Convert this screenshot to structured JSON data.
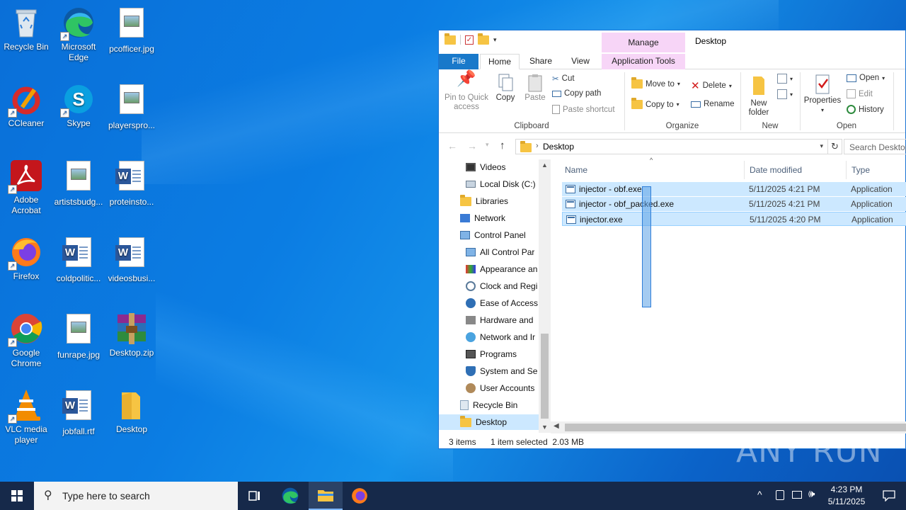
{
  "desktop": {
    "icons": [
      {
        "label": "Recycle Bin"
      },
      {
        "label": "Microsoft Edge"
      },
      {
        "label": "pcofficer.jpg"
      },
      {
        "label": "CCleaner"
      },
      {
        "label": "Skype"
      },
      {
        "label": "playerspro..."
      },
      {
        "label": "Adobe Acrobat"
      },
      {
        "label": "artistsbudg..."
      },
      {
        "label": "proteinsto..."
      },
      {
        "label": "Firefox"
      },
      {
        "label": "coldpolitic..."
      },
      {
        "label": "videosbusi..."
      },
      {
        "label": "Google Chrome"
      },
      {
        "label": "funrape.jpg"
      },
      {
        "label": "Desktop.zip"
      },
      {
        "label": "VLC media player"
      },
      {
        "label": "jobfall.rtf"
      },
      {
        "label": "Desktop"
      }
    ]
  },
  "explorer": {
    "title": "Desktop",
    "context_tab": "Manage",
    "tabs": {
      "file": "File",
      "home": "Home",
      "share": "Share",
      "view": "View",
      "app_tools": "Application Tools"
    },
    "ribbon": {
      "clipboard": {
        "label": "Clipboard",
        "pin": "Pin to Quick access",
        "copy": "Copy",
        "paste": "Paste",
        "cut": "Cut",
        "copy_path": "Copy path",
        "paste_shortcut": "Paste shortcut"
      },
      "organize": {
        "label": "Organize",
        "move_to": "Move to",
        "copy_to": "Copy to",
        "delete": "Delete",
        "rename": "Rename"
      },
      "new": {
        "label": "New",
        "new_folder": "New folder"
      },
      "open": {
        "label": "Open",
        "properties": "Properties",
        "open": "Open",
        "edit": "Edit",
        "history": "History"
      }
    },
    "address": {
      "path": "Desktop",
      "search_placeholder": "Search Desktop"
    },
    "nav_items": [
      {
        "label": "Videos"
      },
      {
        "label": "Local Disk (C:)"
      },
      {
        "label": "Libraries"
      },
      {
        "label": "Network"
      },
      {
        "label": "Control Panel"
      },
      {
        "label": "All Control Par"
      },
      {
        "label": "Appearance an"
      },
      {
        "label": "Clock and Regi"
      },
      {
        "label": "Ease of Access"
      },
      {
        "label": "Hardware and"
      },
      {
        "label": "Network and Ir"
      },
      {
        "label": "Programs"
      },
      {
        "label": "System and Se"
      },
      {
        "label": "User Accounts"
      },
      {
        "label": "Recycle Bin"
      },
      {
        "label": "Desktop"
      }
    ],
    "columns": {
      "name": "Name",
      "date": "Date modified",
      "type": "Type"
    },
    "files": [
      {
        "name": "injector - obf.exe",
        "date": "5/11/2025 4:21 PM",
        "type": "Application"
      },
      {
        "name": "injector - obf_packed.exe",
        "date": "5/11/2025 4:21 PM",
        "type": "Application"
      },
      {
        "name": "injector.exe",
        "date": "5/11/2025 4:20 PM",
        "type": "Application"
      }
    ],
    "status": {
      "count": "3 items",
      "selection": "1 item selected  2.03 MB"
    }
  },
  "taskbar": {
    "search_placeholder": "Type here to search",
    "time": "4:23 PM",
    "date": "5/11/2025"
  },
  "watermark": "ANY RUN",
  "colors": {
    "accent": "#1979ca",
    "selection": "#cce8ff",
    "context_tab": "#f7d5f7",
    "taskbar": "#16294a"
  }
}
